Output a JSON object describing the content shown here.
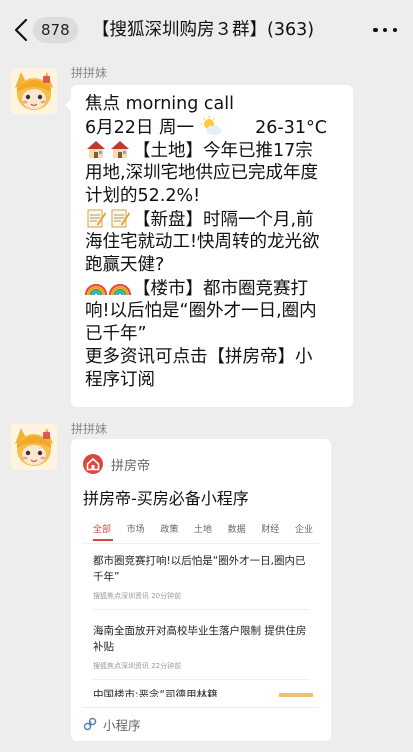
{
  "header": {
    "unread_count": "878",
    "title": "【搜狐深圳购房３群】(363)"
  },
  "messages": [
    {
      "sender": "拼拼妹",
      "lines": {
        "l1": "焦点 morning call",
        "l2_date": "6月22日 周一",
        "l2_temp": "26-31°C",
        "l3": "【土地】今年已推17宗",
        "l4": "用地,深圳宅地供应已完成年度",
        "l5": "计划的52.2%!",
        "l6": "【新盘】时隔一个月,前",
        "l7": "海住宅就动工!快周转的龙光欲",
        "l8": "跑赢天健?",
        "l9": "【楼市】都市圈竞赛打",
        "l10": "响!以后怕是“圈外才一日,圈内",
        "l11": "已千年”",
        "l12": "更多资讯可点击【拼房帝】小",
        "l13": "程序订阅"
      },
      "icons": [
        "house-emoji",
        "memo-emoji",
        "rainbow-emoji",
        "sun-behind-cloud-emoji"
      ]
    },
    {
      "sender": "拼拼妹",
      "card": {
        "source": "拼房帝",
        "title": "拼房帝-买房必备小程序",
        "tabs": [
          "全部",
          "市场",
          "政策",
          "土地",
          "数据",
          "财经",
          "企业"
        ],
        "news": [
          {
            "title": "都市圈竞赛打响!以后怕是“圈外才一日,圈内已千年”",
            "meta": "搜狐焦点深圳资讯 20分钟前"
          },
          {
            "title": "海南全面放开对高校毕业生落户限制 提供住房补贴",
            "meta": "搜狐焦点深圳资讯 22分钟前"
          },
          {
            "title": "中国楼市:恶念“司德用林籍",
            "meta": ""
          }
        ],
        "footer_label": "小程序"
      }
    }
  ],
  "colors": {
    "background": "#ededed",
    "bubble": "#ffffff",
    "accent_red": "#d9483b"
  }
}
